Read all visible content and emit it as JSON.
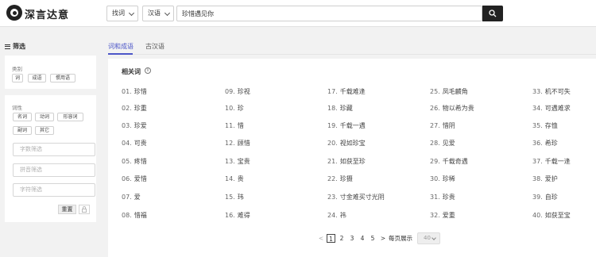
{
  "header": {
    "brand": "深言达意",
    "mode_select": "找词",
    "lang_select": "汉语",
    "query": "珍惜遇见你"
  },
  "sidebar": {
    "title": "筛选",
    "category_label": "类别",
    "category_tags": [
      "词",
      "成语",
      "惯用语"
    ],
    "pos_label": "词性",
    "pos_tags": [
      "名词",
      "动词",
      "形容词",
      "副词",
      "其它"
    ],
    "char_count_placeholder": "字数筛选",
    "pinyin_placeholder": "拼音筛选",
    "char_placeholder": "字符筛选",
    "reset_label": "重置"
  },
  "tabs": [
    "词和成语",
    "古汉语"
  ],
  "results": {
    "title": "相关词",
    "info_glyph": "i",
    "words": [
      {
        "n": "01.",
        "w": "珍惜"
      },
      {
        "n": "02.",
        "w": "珍重"
      },
      {
        "n": "03.",
        "w": "珍爱"
      },
      {
        "n": "04.",
        "w": "可贵"
      },
      {
        "n": "05.",
        "w": "疼惜"
      },
      {
        "n": "06.",
        "w": "爱惜"
      },
      {
        "n": "07.",
        "w": "爱"
      },
      {
        "n": "08.",
        "w": "惜福"
      },
      {
        "n": "09.",
        "w": "珍视"
      },
      {
        "n": "10.",
        "w": "珍"
      },
      {
        "n": "11.",
        "w": "惜"
      },
      {
        "n": "12.",
        "w": "顾惜"
      },
      {
        "n": "13.",
        "w": "宝贵"
      },
      {
        "n": "14.",
        "w": "贵"
      },
      {
        "n": "15.",
        "w": "玮"
      },
      {
        "n": "16.",
        "w": "难得"
      },
      {
        "n": "17.",
        "w": "千载难逢"
      },
      {
        "n": "18.",
        "w": "珍藏"
      },
      {
        "n": "19.",
        "w": "千载一遇"
      },
      {
        "n": "20.",
        "w": "视如珍宝"
      },
      {
        "n": "21.",
        "w": "如获至珍"
      },
      {
        "n": "22.",
        "w": "珍摄"
      },
      {
        "n": "23.",
        "w": "寸金难买寸光阴"
      },
      {
        "n": "24.",
        "w": "祎"
      },
      {
        "n": "25.",
        "w": "凤毛麟角"
      },
      {
        "n": "26.",
        "w": "物以希为贵"
      },
      {
        "n": "27.",
        "w": "惜阴"
      },
      {
        "n": "28.",
        "w": "见爱"
      },
      {
        "n": "29.",
        "w": "千载奇遇"
      },
      {
        "n": "30.",
        "w": "珍稀"
      },
      {
        "n": "31.",
        "w": "珍贵"
      },
      {
        "n": "32.",
        "w": "爱重"
      },
      {
        "n": "33.",
        "w": "机不可失"
      },
      {
        "n": "34.",
        "w": "可遇难求"
      },
      {
        "n": "35.",
        "w": "存恤"
      },
      {
        "n": "36.",
        "w": "希珍"
      },
      {
        "n": "37.",
        "w": "千载一逢"
      },
      {
        "n": "38.",
        "w": "爱护"
      },
      {
        "n": "39.",
        "w": "自珍"
      },
      {
        "n": "40.",
        "w": "如获至宝"
      }
    ]
  },
  "pagination": {
    "prev": "<",
    "pages": [
      "1",
      "2",
      "3",
      "4",
      "5"
    ],
    "current": "1",
    "next": ">",
    "per_page_label": "每页展示",
    "per_page_value": "40"
  },
  "colors": {
    "accent": "#4c56c8",
    "dark": "#222222",
    "background": "#f2f2f2"
  }
}
